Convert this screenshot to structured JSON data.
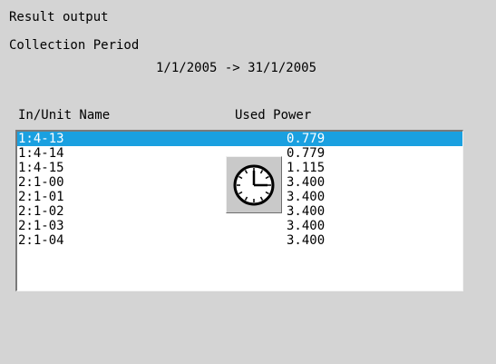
{
  "header": {
    "title": "Result output",
    "period_label": "Collection Period",
    "period_range": "1/1/2005 -> 31/1/2005"
  },
  "table": {
    "columns": [
      "In/Unit Name",
      "Used Power"
    ],
    "rows": [
      {
        "name": "1:4-13",
        "value": "0.779",
        "selected": true
      },
      {
        "name": "1:4-14",
        "value": "0.779"
      },
      {
        "name": "1:4-15",
        "value": "1.115"
      },
      {
        "name": "2:1-00",
        "value": "3.400"
      },
      {
        "name": "2:1-01",
        "value": "3.400"
      },
      {
        "name": "2:1-02",
        "value": "3.400"
      },
      {
        "name": "2:1-03",
        "value": "3.400"
      },
      {
        "name": "2:1-04",
        "value": "3.400"
      }
    ]
  },
  "wait_indicator": {
    "icon": "clock-icon"
  },
  "colors": {
    "background": "#d4d4d4",
    "selection": "#1aa0e0"
  }
}
